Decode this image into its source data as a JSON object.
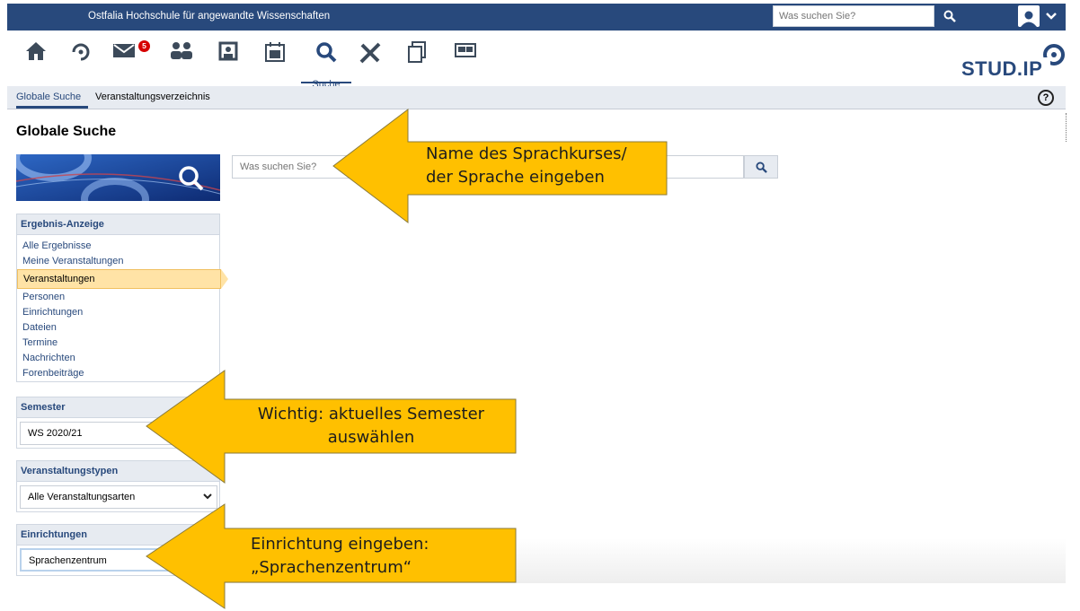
{
  "topbar": {
    "university": "Ostfalia Hochschule für angewandte Wissenschaften",
    "search_placeholder": "Was suchen Sie?"
  },
  "nav": {
    "messages_badge": "5",
    "active_label": "Suche",
    "logo": "STUD.IP"
  },
  "tabs": [
    {
      "label": "Globale Suche",
      "active": true
    },
    {
      "label": "Veranstaltungsverzeichnis",
      "active": false
    }
  ],
  "help_icon": "?",
  "page_title": "Globale Suche",
  "main_search": {
    "placeholder": "Was suchen Sie?"
  },
  "result_filter": {
    "title": "Ergebnis-Anzeige",
    "items": [
      "Alle Ergebnisse",
      "Meine Veranstaltungen",
      "Veranstaltungen",
      "Personen",
      "Einrichtungen",
      "Dateien",
      "Termine",
      "Nachrichten",
      "Forenbeiträge"
    ],
    "selected": "Veranstaltungen"
  },
  "semester": {
    "title": "Semester",
    "value": "WS 2020/21"
  },
  "course_types": {
    "title": "Veranstaltungstypen",
    "value": "Alle Veranstaltungsarten"
  },
  "institutes": {
    "title": "Einrichtungen",
    "value": "Sprachenzentrum"
  },
  "annotations": {
    "search_line1": "Name des Sprachkurses/",
    "search_line2": "der Sprache eingeben",
    "semester_line1": "Wichtig: aktuelles Semester",
    "semester_line2": "auswählen",
    "institute_line1": "Einrichtung eingeben:",
    "institute_line2": "„Sprachenzentrum“"
  },
  "colors": {
    "brand": "#28497c",
    "annotation_fill": "#ffc000",
    "selected_item": "#ffe3a6",
    "badge": "#d60000"
  }
}
